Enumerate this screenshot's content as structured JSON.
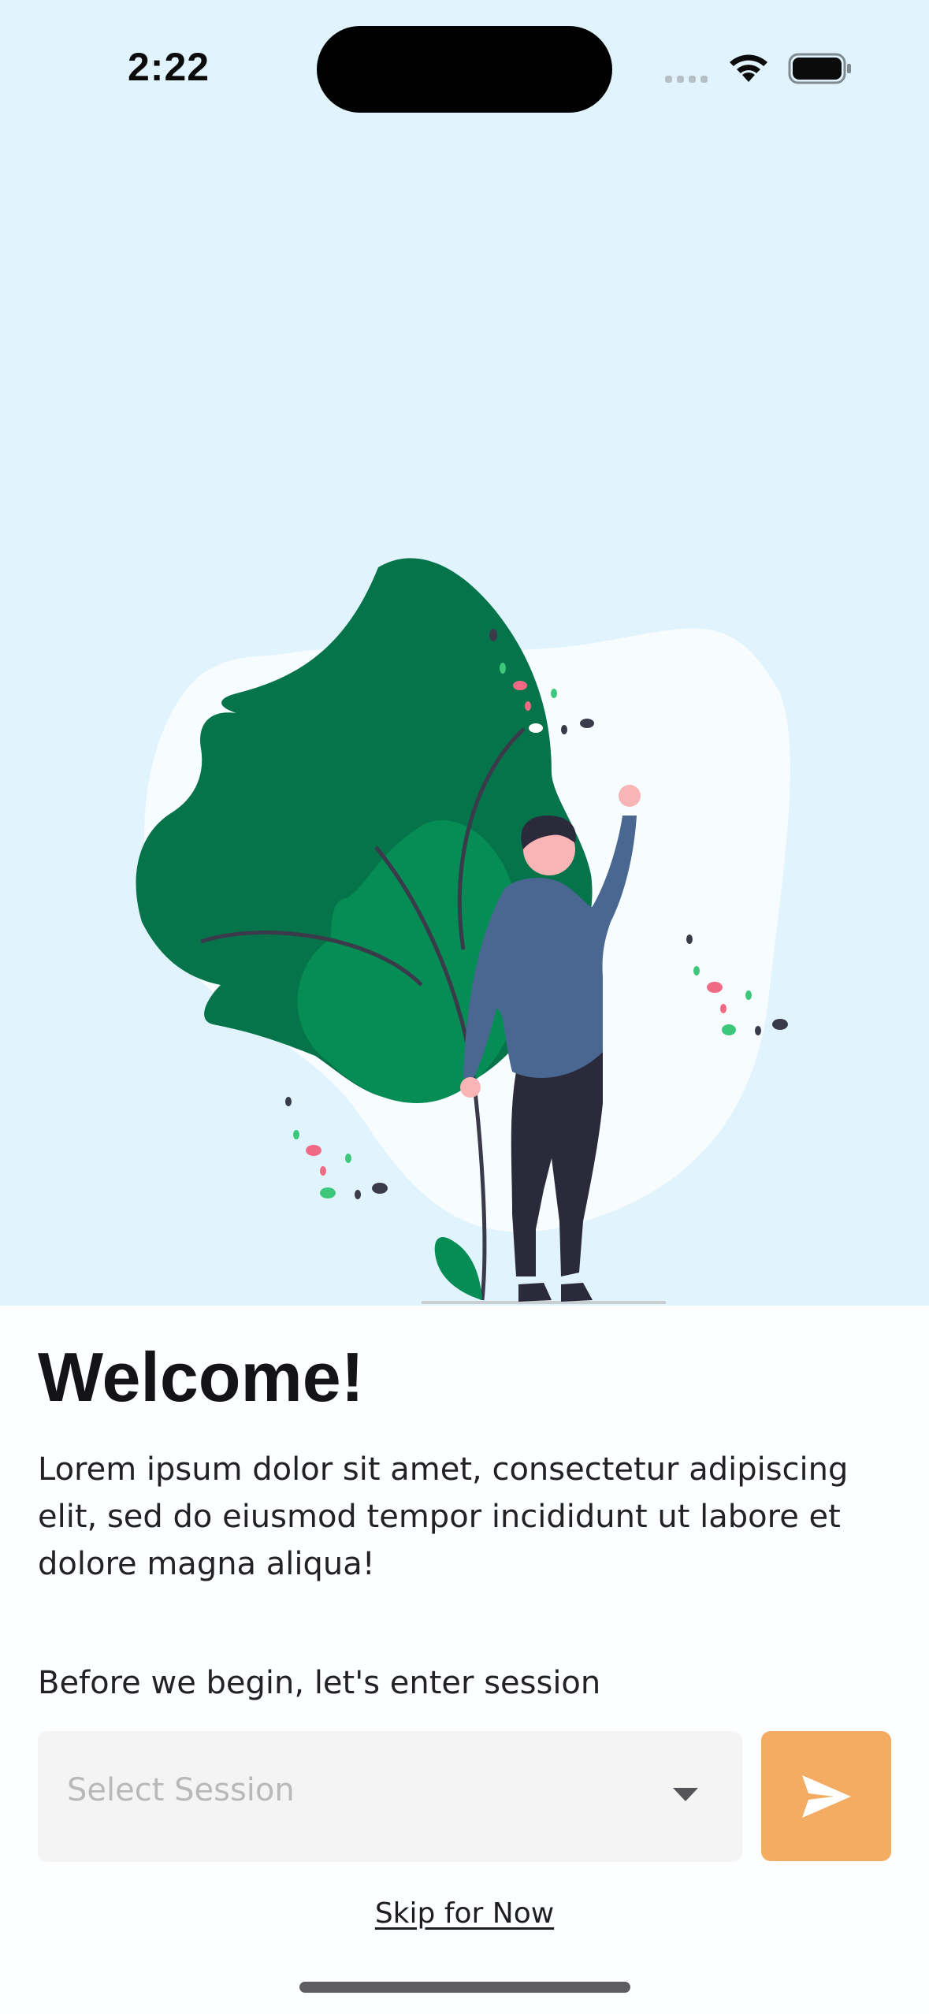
{
  "status_bar": {
    "time": "2:22"
  },
  "welcome": {
    "title": "Welcome!",
    "body": "Lorem ipsum dolor sit amet, consectetur adipiscing elit, sed do eiusmod tempor incididunt ut labore et dolore magna aliqua!"
  },
  "session": {
    "label": "Before we begin, let's enter session",
    "placeholder": "Select Session"
  },
  "skip": {
    "label": "Skip for Now"
  },
  "colors": {
    "hero_background": "#e1f4fd",
    "accent": "#f3ac62",
    "leaf_dark": "#05744a",
    "leaf_light": "#068c55",
    "person_shirt": "#4a6791"
  },
  "icons": {
    "send": "send-arrow-icon",
    "dropdown": "caret-down-icon",
    "wifi": "wifi-icon",
    "battery": "battery-icon"
  }
}
